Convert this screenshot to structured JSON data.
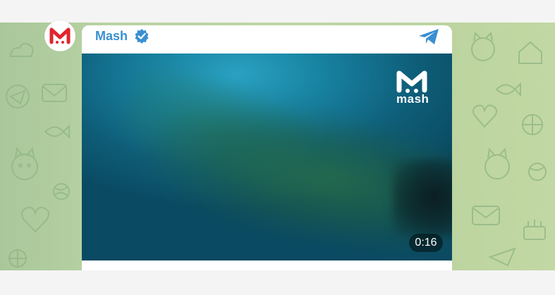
{
  "channel": {
    "name": "Mash",
    "avatar_icon": "mash-logo-icon",
    "verified_icon": "verified-badge-icon",
    "share_icon": "telegram-plane-icon"
  },
  "video": {
    "watermark_text": "mash",
    "watermark_icon": "mash-logo-icon",
    "duration": "0:16"
  },
  "colors": {
    "accent": "#3a8fd1",
    "chat_background": "#b8d3a4",
    "brand_red": "#e0242f"
  }
}
